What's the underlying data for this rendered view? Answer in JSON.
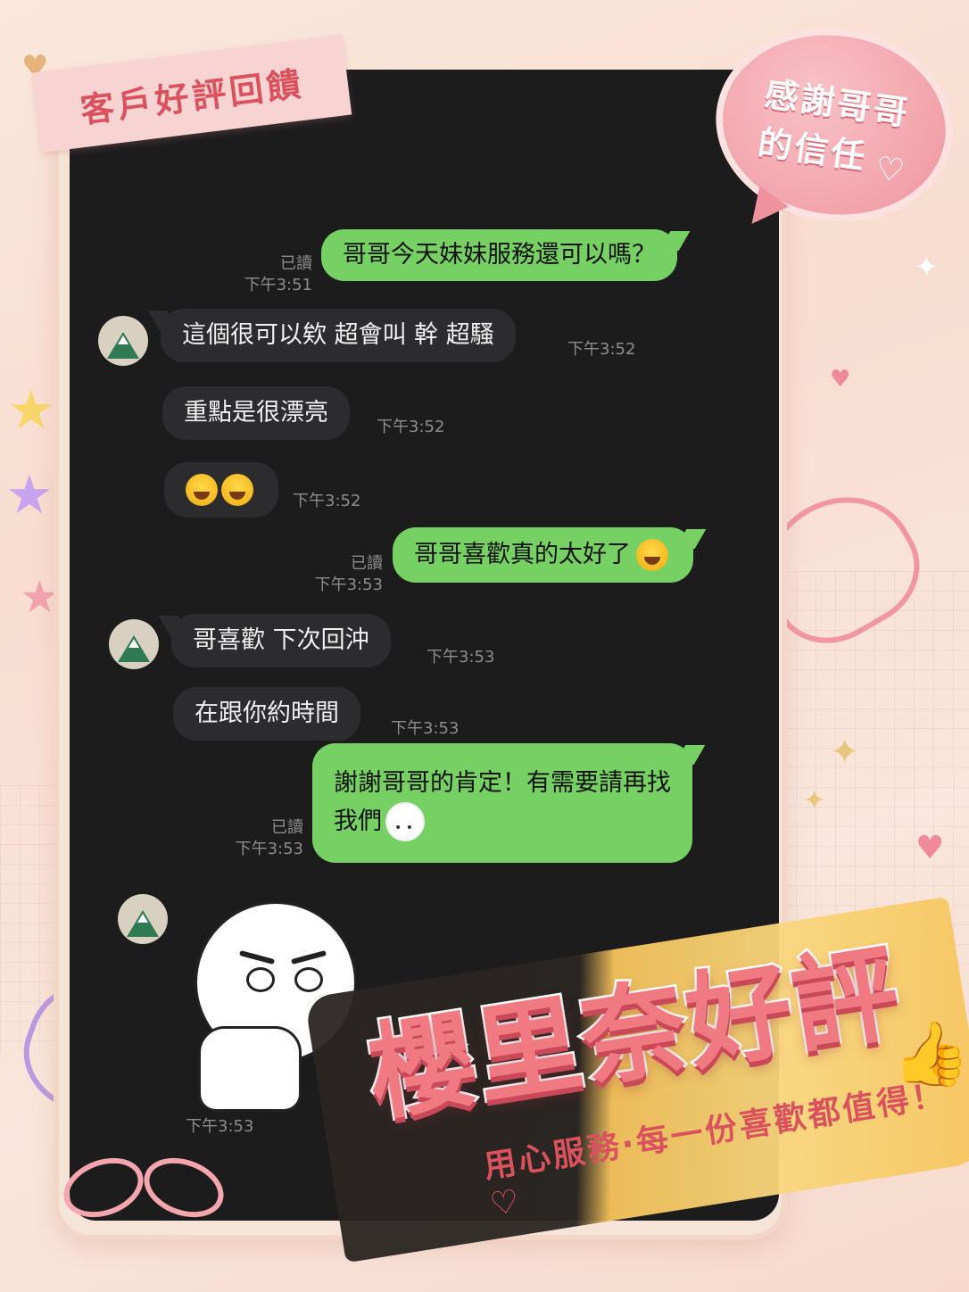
{
  "header_tape": {
    "title": "客戶好評回饋"
  },
  "speech_bubble": {
    "line1": "感謝哥哥",
    "line2": "的信任",
    "heart": "♡"
  },
  "chat": {
    "messages": [
      {
        "dir": "out",
        "text": "哥哥今天妹妹服務還可以嗎？",
        "read": "已讀",
        "time": "下午3:51"
      },
      {
        "dir": "in",
        "text": "這個很可以欸  超會叫  幹  超騷",
        "time": "下午3:52"
      },
      {
        "dir": "in",
        "text": "重點是很漂亮",
        "time": "下午3:52"
      },
      {
        "dir": "in",
        "text": "",
        "emoji": "face-with-tears-of-joy x2",
        "time": "下午3:52"
      },
      {
        "dir": "out",
        "text": "哥哥喜歡真的太好了",
        "emoji": "pleading-face",
        "read": "已讀",
        "time": "下午3:53"
      },
      {
        "dir": "in",
        "text": "哥喜歡  下次回沖",
        "time": "下午3:53"
      },
      {
        "dir": "in",
        "text": "在跟你約時間",
        "time": "下午3:53"
      },
      {
        "dir": "out",
        "text_line1": "謝謝哥哥的肯定！有需要請再找",
        "text_line2": "我們",
        "read": "已讀",
        "time": "下午3:53"
      },
      {
        "dir": "in",
        "sticker": "thumbs-up-moon-sticker",
        "time": "下午3:53"
      }
    ]
  },
  "banner": {
    "title": "櫻里奈好評",
    "subtitle": "用心服務·每一份喜歡都值得！♡"
  },
  "colors": {
    "outgoing": "#76d064",
    "incoming": "#2c2c2e",
    "screen": "#1c1c1d",
    "accent": "#f07a82"
  }
}
